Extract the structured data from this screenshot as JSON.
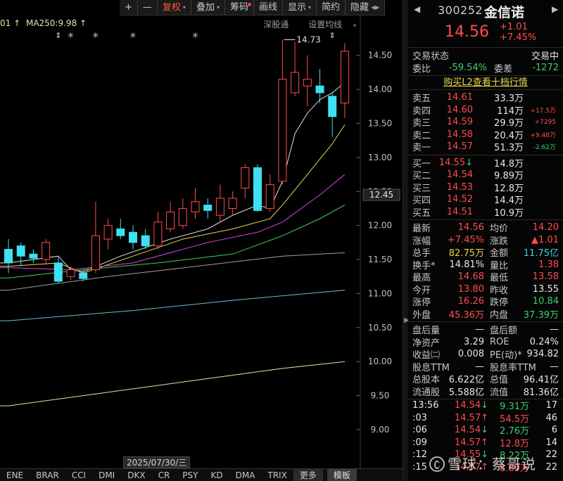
{
  "toolbar": {
    "buttons": [
      {
        "label": "+"
      },
      {
        "label": "—"
      },
      {
        "label": "复权",
        "active": true,
        "caret": "▾"
      },
      {
        "label": "叠加",
        "caret": "▾"
      },
      {
        "label": "筹码",
        "dot": true
      },
      {
        "label": "画线"
      },
      {
        "label": "显示",
        "caret": "▾"
      },
      {
        "label": "简约"
      },
      {
        "label": "隐藏",
        "caret": "◀▶"
      }
    ]
  },
  "legend": {
    "ma_prev": "01 ↑",
    "ma250": "MA250:9.98 ↑",
    "links": [
      "深股通",
      "设置均线"
    ],
    "caret": "▾"
  },
  "chart_data": {
    "type": "candlestick",
    "ylim": [
      8.7,
      14.9
    ],
    "y_ticks": [
      "14.50",
      "14.00",
      "13.50",
      "13.00",
      "12.50",
      "12.00",
      "11.50",
      "11.00",
      "10.50",
      "10.00",
      "9.50",
      "9.00"
    ],
    "current_price_label": "12.45",
    "high_marker": "14.73",
    "date_label": "2025/07/30/三",
    "marker_symbols": [
      "⇕",
      "✳",
      "✳",
      "✳",
      "✳",
      "⇕"
    ],
    "candles": [
      {
        "o": 11.65,
        "c": 11.45,
        "h": 11.8,
        "l": 11.3
      },
      {
        "o": 11.7,
        "c": 11.55,
        "h": 11.75,
        "l": 11.4
      },
      {
        "o": 11.58,
        "c": 11.52,
        "h": 11.65,
        "l": 11.45
      },
      {
        "o": 11.5,
        "c": 11.75,
        "h": 11.8,
        "l": 11.42
      },
      {
        "o": 11.45,
        "c": 11.18,
        "h": 11.55,
        "l": 11.15
      },
      {
        "o": 11.25,
        "c": 11.35,
        "h": 11.4,
        "l": 11.2
      },
      {
        "o": 11.3,
        "c": 11.22,
        "h": 11.35,
        "l": 11.18
      },
      {
        "o": 11.35,
        "c": 11.85,
        "h": 12.35,
        "l": 11.3
      },
      {
        "o": 11.8,
        "c": 12.0,
        "h": 12.1,
        "l": 11.65
      },
      {
        "o": 11.95,
        "c": 11.85,
        "h": 12.1,
        "l": 11.8
      },
      {
        "o": 11.9,
        "c": 11.75,
        "h": 12.0,
        "l": 11.65
      },
      {
        "o": 11.85,
        "c": 11.7,
        "h": 11.95,
        "l": 11.65
      },
      {
        "o": 11.7,
        "c": 12.05,
        "h": 12.2,
        "l": 11.65
      },
      {
        "o": 11.95,
        "c": 12.2,
        "h": 12.35,
        "l": 11.9
      },
      {
        "o": 12.0,
        "c": 12.25,
        "h": 12.4,
        "l": 11.95
      },
      {
        "o": 12.2,
        "c": 12.35,
        "h": 12.55,
        "l": 12.1
      },
      {
        "o": 12.3,
        "c": 12.22,
        "h": 12.4,
        "l": 12.1
      },
      {
        "o": 12.15,
        "c": 12.4,
        "h": 12.6,
        "l": 12.05
      },
      {
        "o": 12.25,
        "c": 12.4,
        "h": 12.5,
        "l": 12.15
      },
      {
        "o": 12.55,
        "c": 12.85,
        "h": 12.9,
        "l": 12.4
      },
      {
        "o": 12.85,
        "c": 12.22,
        "h": 12.9,
        "l": 12.2
      },
      {
        "o": 12.25,
        "c": 12.6,
        "h": 12.75,
        "l": 12.2
      },
      {
        "o": 12.65,
        "c": 14.15,
        "h": 14.73,
        "l": 12.6
      },
      {
        "o": 13.95,
        "c": 14.25,
        "h": 14.7,
        "l": 13.9
      },
      {
        "o": 14.05,
        "c": 14.15,
        "h": 14.5,
        "l": 13.75
      },
      {
        "o": 14.05,
        "c": 13.95,
        "h": 14.3,
        "l": 13.8
      },
      {
        "o": 13.9,
        "c": 13.6,
        "h": 13.95,
        "l": 13.3
      },
      {
        "o": 13.8,
        "c": 14.56,
        "h": 14.68,
        "l": 13.58
      }
    ],
    "series": [
      {
        "points": [
          [
            0,
            11.45
          ],
          [
            4,
            11.55
          ],
          [
            5,
            11.35
          ],
          [
            6,
            11.32
          ],
          [
            9,
            11.55
          ],
          [
            13,
            11.8
          ],
          [
            16,
            11.95
          ],
          [
            18,
            12.15
          ],
          [
            20,
            12.3
          ],
          [
            21,
            12.25
          ],
          [
            22,
            12.65
          ],
          [
            23,
            13.35
          ],
          [
            24,
            13.65
          ],
          [
            25,
            13.85
          ],
          [
            26,
            13.95
          ],
          [
            27,
            14.1
          ]
        ],
        "color": "#e0e0e0"
      },
      {
        "points": [
          [
            0,
            11.4
          ],
          [
            4,
            11.45
          ],
          [
            6,
            11.3
          ],
          [
            10,
            11.55
          ],
          [
            14,
            11.8
          ],
          [
            18,
            11.95
          ],
          [
            21,
            12.1
          ],
          [
            22,
            12.3
          ],
          [
            24,
            12.75
          ],
          [
            26,
            13.2
          ],
          [
            27,
            13.48
          ]
        ],
        "color": "#e8d84a"
      },
      {
        "points": [
          [
            0,
            11.38
          ],
          [
            5,
            11.35
          ],
          [
            10,
            11.45
          ],
          [
            16,
            11.75
          ],
          [
            20,
            11.9
          ],
          [
            22,
            12.05
          ],
          [
            25,
            12.45
          ],
          [
            27,
            12.75
          ]
        ],
        "color": "#e040e0"
      },
      {
        "points": [
          [
            0,
            11.23
          ],
          [
            6,
            11.35
          ],
          [
            12,
            11.45
          ],
          [
            18,
            11.58
          ],
          [
            22,
            11.85
          ],
          [
            25,
            12.1
          ],
          [
            27,
            12.3
          ]
        ],
        "color": "#40d060"
      },
      {
        "points": [
          [
            0,
            11.05
          ],
          [
            8,
            11.25
          ],
          [
            16,
            11.42
          ],
          [
            22,
            11.55
          ],
          [
            27,
            11.6
          ]
        ],
        "color": "#a0a0a0"
      },
      {
        "points": [
          [
            0,
            10.6
          ],
          [
            10,
            10.75
          ],
          [
            18,
            10.9
          ],
          [
            24,
            11.0
          ],
          [
            27,
            11.05
          ]
        ],
        "color": "#6fb8d8"
      },
      {
        "points": [
          [
            0,
            9.35
          ],
          [
            8,
            9.55
          ],
          [
            16,
            9.75
          ],
          [
            22,
            9.9
          ],
          [
            27,
            10.0
          ]
        ],
        "color": "#e8e0a8"
      }
    ]
  },
  "bottom_bar": {
    "items": [
      "ENE",
      "BRAR",
      "CCI",
      "DMI",
      "DKX",
      "CR",
      "PSY",
      "KD",
      "DMA",
      "TRIX"
    ],
    "more": "更多",
    "template": "模板"
  },
  "quote": {
    "code": "300252",
    "name": "金信诺",
    "price": "14.56",
    "change": "+1.01",
    "change_pct": "+7.45%",
    "nav_left": "◀",
    "nav_right": "▶",
    "trade_status_label": "交易状态",
    "trade_status_value": "交易中",
    "weibi_label": "委比",
    "weibi_value": "-59.54%",
    "weicha_label": "委差",
    "weicha_value": "-1272",
    "l2_link": "购买L2查看十档行情",
    "asks": [
      {
        "label": "卖五",
        "price": "14.61",
        "vol": "33.3万",
        "delta": ""
      },
      {
        "label": "卖四",
        "price": "14.60",
        "vol": "114万",
        "delta": "+17.5万"
      },
      {
        "label": "卖三",
        "price": "14.59",
        "vol": "29.9万",
        "delta": "+7295"
      },
      {
        "label": "卖二",
        "price": "14.58",
        "vol": "20.4万",
        "delta": "+9.48万"
      },
      {
        "label": "卖一",
        "price": "14.57",
        "vol": "51.3万",
        "delta": "-2.62万"
      }
    ],
    "bids": [
      {
        "label": "买一",
        "price": "14.55",
        "arrow": "↓",
        "vol": "14.8万"
      },
      {
        "label": "买二",
        "price": "14.54",
        "arrow": "",
        "vol": "9.89万"
      },
      {
        "label": "买三",
        "price": "14.53",
        "arrow": "",
        "vol": "12.8万"
      },
      {
        "label": "买四",
        "price": "14.52",
        "arrow": "",
        "vol": "14.4万"
      },
      {
        "label": "买五",
        "price": "14.51",
        "arrow": "",
        "vol": "10.9万"
      }
    ],
    "stats": [
      {
        "a": "最新",
        "b": "14.56",
        "bc": "red",
        "c": "均价",
        "d": "14.20",
        "dc": "red"
      },
      {
        "a": "涨幅",
        "b": "+7.45%",
        "bc": "red",
        "c": "涨跌",
        "d": "▲1.01",
        "dc": "red"
      },
      {
        "a": "总手",
        "b": "82.75万",
        "bc": "yellow",
        "c": "金额",
        "d": "11.75亿",
        "dc": "cyan"
      },
      {
        "a": "换手*",
        "b": "14.81%",
        "bc": "white",
        "c": "量比",
        "d": "1.38",
        "dc": "red"
      },
      {
        "a": "最高",
        "b": "14.68",
        "bc": "red",
        "c": "最低",
        "d": "13.58",
        "dc": "red"
      },
      {
        "a": "今开",
        "b": "13.80",
        "bc": "red",
        "c": "昨收",
        "d": "13.55",
        "dc": "white"
      },
      {
        "a": "涨停",
        "b": "16.26",
        "bc": "red",
        "c": "跌停",
        "d": "10.84",
        "dc": "green"
      },
      {
        "a": "外盘",
        "b": "45.36万",
        "bc": "red",
        "c": "内盘",
        "d": "37.39万",
        "dc": "green"
      }
    ],
    "stats2": [
      {
        "a": "盘后量",
        "b": "—",
        "bc": "white",
        "c": "盘后额",
        "d": "—",
        "dc": "white"
      },
      {
        "a": "净资产",
        "b": "3.29",
        "bc": "white",
        "c": "ROE",
        "d": "0.24%",
        "dc": "white"
      },
      {
        "a": "收益㈡",
        "b": "0.008",
        "bc": "white",
        "c": "PE(动)*",
        "d": "934.82",
        "dc": "white"
      },
      {
        "a": "股息TTM",
        "b": "—",
        "bc": "white",
        "c": "股息率TTM",
        "d": "—",
        "dc": "white"
      },
      {
        "a": "总股本",
        "b": "6.622亿",
        "bc": "white",
        "c": "总值",
        "d": "96.41亿",
        "dc": "white"
      },
      {
        "a": "流通股",
        "b": "5.588亿",
        "bc": "white",
        "c": "流值",
        "d": "81.36亿",
        "dc": "white"
      }
    ],
    "ticks": [
      {
        "time": "13:56",
        "price": "14.54",
        "pc": "red",
        "arrow": "↓",
        "ac": "green",
        "vol": "9.31万",
        "vc": "green",
        "n": "17"
      },
      {
        "time": ":03",
        "price": "14.57",
        "pc": "red",
        "arrow": "↑",
        "ac": "red",
        "vol": "54.5万",
        "vc": "red",
        "n": "46"
      },
      {
        "time": ":06",
        "price": "14.54",
        "pc": "red",
        "arrow": "↓",
        "ac": "green",
        "vol": "2.76万",
        "vc": "green",
        "n": "6"
      },
      {
        "time": ":09",
        "price": "14.57",
        "pc": "red",
        "arrow": "↑",
        "ac": "red",
        "vol": "12.8万",
        "vc": "red",
        "n": "14"
      },
      {
        "time": ":12",
        "price": "14.55",
        "pc": "red",
        "arrow": "↓",
        "ac": "green",
        "vol": "8.22万",
        "vc": "green",
        "n": "22"
      },
      {
        "time": ":15",
        "price": "14.57",
        "pc": "red",
        "arrow": "↑",
        "ac": "red",
        "vol": "8.89万",
        "vc": "red",
        "n": "22"
      }
    ]
  },
  "watermark": "雪球：蔡哥说",
  "colors": {
    "up": "#ff4d4d",
    "down": "#3fe0f0",
    "bg": "#000000"
  }
}
